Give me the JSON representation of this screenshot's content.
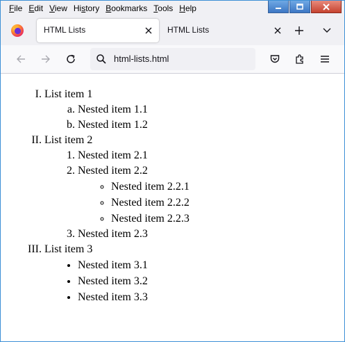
{
  "menu": [
    {
      "key": "F",
      "rest": "ile"
    },
    {
      "key": "E",
      "rest": "dit"
    },
    {
      "key": "V",
      "rest": "iew"
    },
    {
      "pre": "Hi",
      "key": "s",
      "rest": "tory"
    },
    {
      "key": "B",
      "rest": "ookmarks"
    },
    {
      "key": "T",
      "rest": "ools"
    },
    {
      "key": "H",
      "rest": "elp"
    }
  ],
  "tabs": [
    {
      "title": "HTML Lists",
      "active": true
    },
    {
      "title": "HTML Lists",
      "active": false
    }
  ],
  "urlbar": {
    "url": "html-lists.html"
  },
  "content": {
    "list": [
      {
        "label": "List item 1",
        "style": "lower-alpha",
        "children": [
          {
            "label": "Nested item 1.1"
          },
          {
            "label": "Nested item 1.2"
          }
        ]
      },
      {
        "label": "List item 2",
        "style": "decimal",
        "children": [
          {
            "label": "Nested item 2.1"
          },
          {
            "label": "Nested item 2.2",
            "children": [
              {
                "label": "Nested item 2.2.1"
              },
              {
                "label": "Nested item 2.2.2"
              },
              {
                "label": "Nested item 2.2.3"
              }
            ]
          },
          {
            "label": "Nested item 2.3"
          }
        ]
      },
      {
        "label": "List item 3",
        "style": "disc",
        "children": [
          {
            "label": "Nested item 3.1"
          },
          {
            "label": "Nested item 3.2"
          },
          {
            "label": "Nested item 3.3"
          }
        ]
      }
    ]
  },
  "colors": {
    "accent": "#3c8fd6",
    "close_button": "#c64330",
    "toolbar": "#f0f0f4"
  }
}
